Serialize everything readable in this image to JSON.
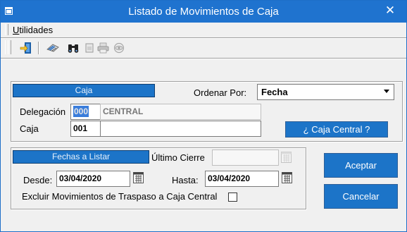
{
  "window": {
    "title": "Listado de Movimientos de Caja",
    "close_glyph": "✕"
  },
  "menu": {
    "utilidades_first": "U",
    "utilidades_rest": "tilidades"
  },
  "toolbar": {
    "icons": [
      "exit-icon",
      "report-icon",
      "binoculars-icon",
      "page-icon",
      "print-icon",
      "eye-icon"
    ]
  },
  "caja": {
    "header": "Caja",
    "ordenar_label": "Ordenar Por:",
    "ordenar_value": "Fecha",
    "delegacion_label": "Delegación",
    "delegacion_code": "000",
    "delegacion_name": "CENTRAL",
    "caja_label": "Caja",
    "caja_code": "001",
    "caja_name": "",
    "central_button": "¿ Caja Central ?"
  },
  "fechas": {
    "header": "Fechas a Listar",
    "ultimo_cierre_label": "Último Cierre",
    "ultimo_cierre_value": "",
    "desde_label": "Desde:",
    "desde_value": "03/04/2020",
    "hasta_label": "Hasta:",
    "hasta_value": "03/04/2020",
    "excluir_label": "Excluir Movimientos de Traspaso a Caja Central",
    "excluir_checked": false
  },
  "actions": {
    "aceptar": "Aceptar",
    "cancelar": "Cancelar"
  },
  "colors": {
    "titlebar": "#1f73cf",
    "accent": "#1c74c8",
    "window_bg": "#f0f0f0"
  }
}
